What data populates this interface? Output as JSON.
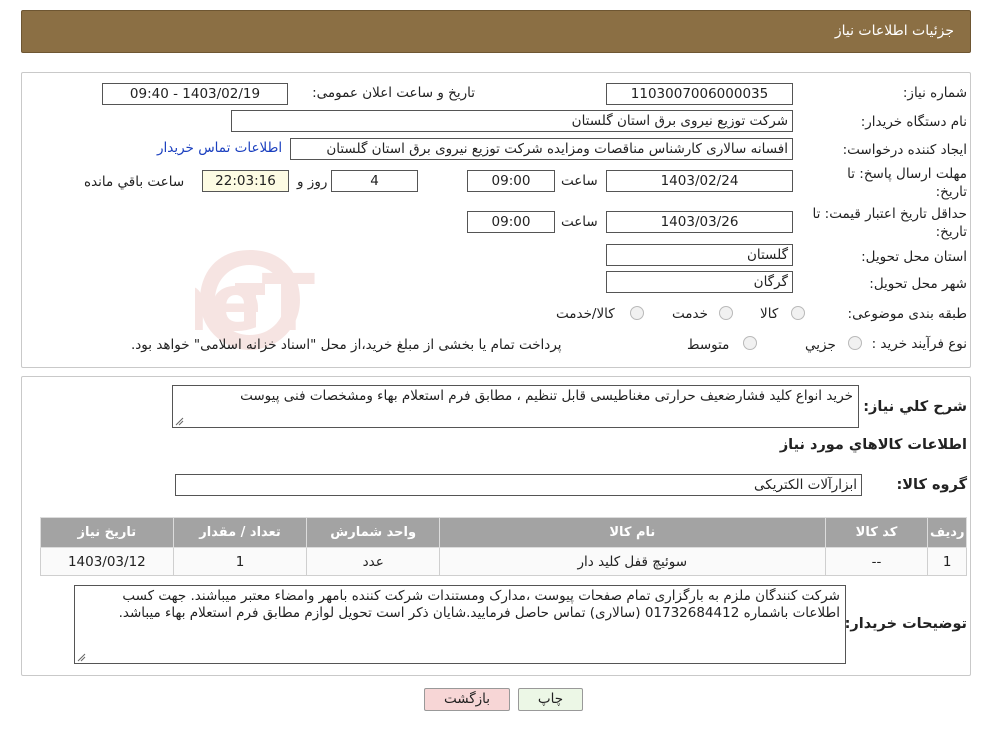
{
  "page_title": "جزئیات اطلاعات نیاز",
  "need_number": {
    "label": "شماره نیاز:",
    "value": "1103007006000035"
  },
  "announce": {
    "label": "تاریخ و ساعت اعلان عمومی:",
    "value": "1403/02/19 - 09:40"
  },
  "buyer_org": {
    "label": "نام دستگاه خریدار:",
    "value": "شرکت توزیع نیروی برق استان گلستان"
  },
  "requester": {
    "label": "ایجاد کننده درخواست:",
    "value": "افسانه سالاری کارشناس مناقصات ومزایده شرکت توزیع نیروی برق استان گلستان",
    "contact_link": "اطلاعات تماس خریدار"
  },
  "reply_deadline": {
    "label_line1": "مهلت ارسال پاسخ: تا",
    "label_line2": "تاریخ:",
    "date": "1403/02/24",
    "time_label": "ساعت",
    "time": "09:00",
    "days": "4",
    "days_label": "روز و",
    "remaining": "22:03:16",
    "remaining_label": "ساعت باقي مانده"
  },
  "price_validity": {
    "label_line1": "حداقل تاریخ اعتبار قیمت: تا",
    "label_line2": "تاریخ:",
    "date": "1403/03/26",
    "time_label": "ساعت",
    "time": "09:00"
  },
  "delivery_province": {
    "label": "استان محل تحویل:",
    "value": "گلستان"
  },
  "delivery_city": {
    "label": "شهر محل تحویل:",
    "value": "گرگان"
  },
  "category": {
    "label": "طبقه بندی موضوعی:",
    "options": [
      "کالا",
      "خدمت",
      "کالا/خدمت"
    ]
  },
  "purchase_process": {
    "label": "نوع فرآیند خرید :",
    "options": [
      "جزیي",
      "متوسط"
    ],
    "note": "پرداخت تمام یا بخشی از مبلغ خرید،از محل \"اسناد خزانه اسلامی\" خواهد بود."
  },
  "summary": {
    "label": "شرح کلي نياز:",
    "value": "خرید انواع کلید فشارضعیف حرارتی مغناطیسی قابل تنظیم ، مطابق فرم استعلام بهاء ومشخصات فنی پیوست"
  },
  "goods_section_title": "اطلاعات کالاهاي مورد نياز",
  "goods_group": {
    "label": "گروه کالا:",
    "value": "ابزارآلات الکتریکی"
  },
  "table": {
    "headers": [
      "رديف",
      "کد کالا",
      "نام کالا",
      "واحد شمارش",
      "تعداد / مقدار",
      "تاریخ نیاز"
    ],
    "rows": [
      [
        "1",
        "--",
        "سوئیچ قفل کلید دار",
        "عدد",
        "1",
        "1403/03/12"
      ]
    ]
  },
  "buyer_notes": {
    "label": "توضیحات خریدار:",
    "value": "شرکت کنندگان ملزم به بارگزاری تمام صفحات پیوست ،مدارک ومستندات شرکت کننده بامهر وامضاء معتبر میباشند. جهت کسب اطلاعات باشماره 01732684412 (سالاری) تماس حاصل فرمایید.شایان ذکر است تحویل لوازم مطابق فرم استعلام بهاء میباشد."
  },
  "buttons": {
    "print": "چاپ",
    "back": "بازگشت"
  },
  "watermark_text": "AriaTender.neT",
  "colors": {
    "title_bar": "#8b6f44",
    "link": "#1a3fbf",
    "table_header": "#a3a3a3",
    "back_button": "#f7d6d6",
    "print_button": "#ecf7e6"
  }
}
